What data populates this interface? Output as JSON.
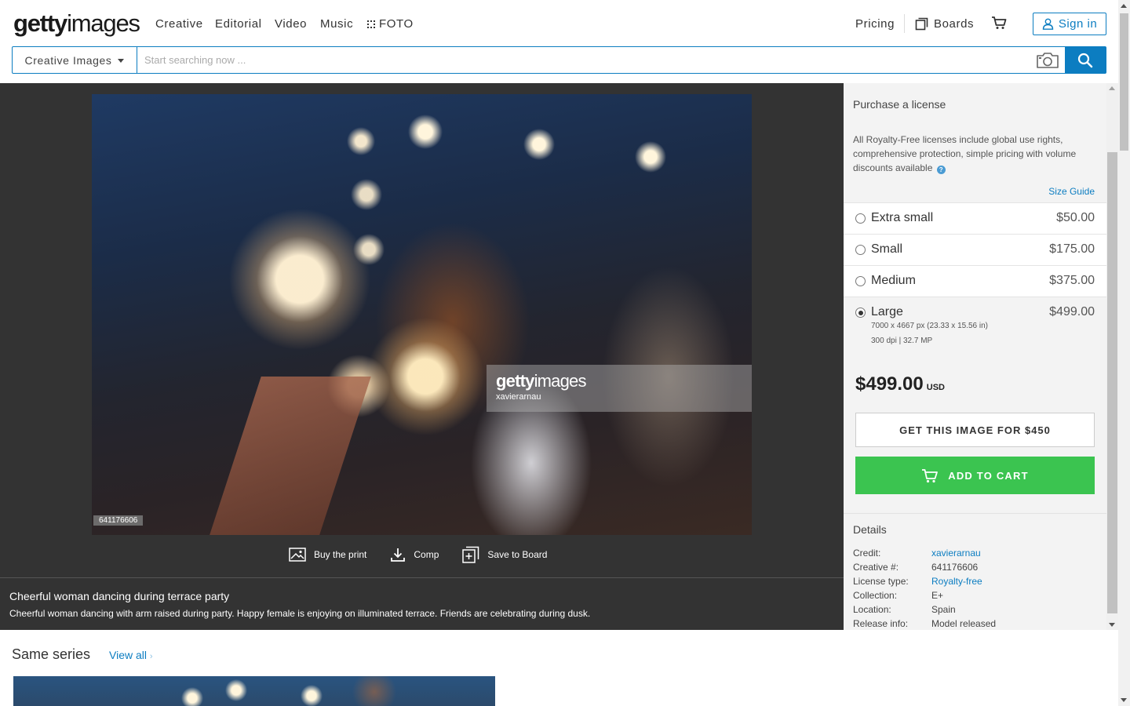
{
  "header": {
    "logo_bold": "getty",
    "logo_light": "images",
    "nav": [
      "Creative",
      "Editorial",
      "Video",
      "Music"
    ],
    "foto": "FOTO",
    "pricing": "Pricing",
    "boards": "Boards",
    "sign_in": "Sign in"
  },
  "search": {
    "type": "Creative Images",
    "placeholder": "Start searching now ..."
  },
  "image": {
    "watermark_logo_bold": "getty",
    "watermark_logo_light": "images",
    "watermark_credit": "xavierarnau",
    "id": "641176606"
  },
  "actions": {
    "buy_print": "Buy the print",
    "comp": "Comp",
    "save_board": "Save to Board"
  },
  "caption": {
    "title": "Cheerful woman dancing during terrace party",
    "description": "Cheerful woman dancing with arm raised during party. Happy female is enjoying on illuminated terrace. Friends are celebrating during dusk."
  },
  "license": {
    "title": "Purchase a license",
    "info": "All Royalty-Free licenses include global use rights, comprehensive protection, simple pricing with volume discounts available",
    "size_guide": "Size Guide",
    "sizes": [
      {
        "name": "Extra small",
        "price": "$50.00"
      },
      {
        "name": "Small",
        "price": "$175.00"
      },
      {
        "name": "Medium",
        "price": "$375.00"
      },
      {
        "name": "Large",
        "price": "$499.00",
        "dims": "7000 x 4667 px (23.33 x 15.56 in)",
        "res": "300 dpi | 32.7 MP"
      }
    ],
    "selected": "Large",
    "total": "$499.00",
    "currency": "USD",
    "get_button": "GET THIS IMAGE FOR $450",
    "cart_button": "ADD TO CART"
  },
  "details": {
    "title": "Details",
    "rows": [
      {
        "label": "Credit:",
        "value": "xavierarnau"
      },
      {
        "label": "Creative #:",
        "value": "641176606"
      },
      {
        "label": "License type:",
        "value": "Royalty-free"
      },
      {
        "label": "Collection:",
        "value": "E+"
      },
      {
        "label": "Location:",
        "value": "Spain"
      },
      {
        "label": "Release info:",
        "value": "Model released"
      }
    ]
  },
  "series": {
    "title": "Same series",
    "view_all": "View all"
  },
  "colors": {
    "brand_blue": "#0c7dc1",
    "cart_green": "#3bc450",
    "viewer_bg": "#333333"
  }
}
